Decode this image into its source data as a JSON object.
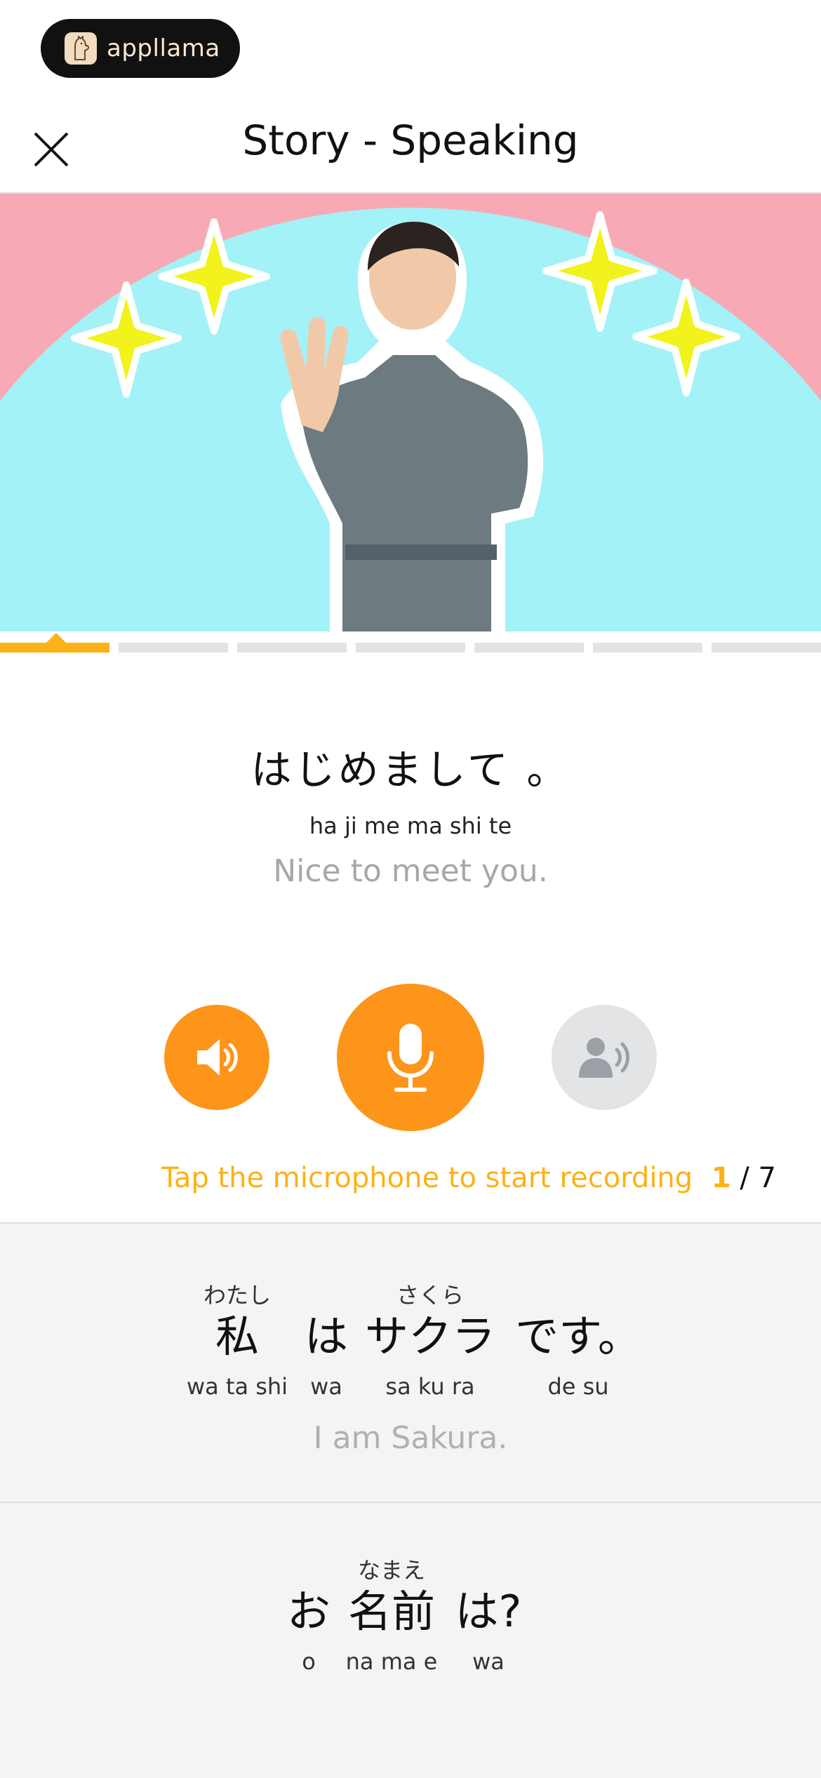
{
  "brand": {
    "name": "appllama"
  },
  "header": {
    "title": "Story - Speaking"
  },
  "progress": {
    "total_segments": 7,
    "current": 1
  },
  "current_sentence": {
    "japanese": "はじめまして 。",
    "romaji": "ha ji me ma shi te",
    "english": "Nice to meet you."
  },
  "controls": {
    "play_audio": "speaker-icon",
    "record": "microphone-icon",
    "playback": "user-voice-icon"
  },
  "hint": {
    "text": "Tap the microphone to start recording",
    "counter_current": "1",
    "counter_total": "/ 7"
  },
  "sentences": [
    {
      "words": [
        {
          "ruby": "わたし",
          "text": "私",
          "romaji": "wa ta shi"
        },
        {
          "ruby": "",
          "text": "は",
          "romaji": "wa"
        },
        {
          "ruby": "さくら",
          "text": "サクラ",
          "romaji": "sa ku ra"
        },
        {
          "ruby": "",
          "text": "です。",
          "romaji": "de su"
        }
      ],
      "english": "I am Sakura."
    },
    {
      "words": [
        {
          "ruby": "",
          "text": "お",
          "romaji": "o"
        },
        {
          "ruby": "なまえ",
          "text": "名前",
          "romaji": "na ma e"
        },
        {
          "ruby": "",
          "text": "は?",
          "romaji": "wa"
        }
      ]
    }
  ],
  "colors": {
    "accent": "#fc951a",
    "progress_active": "#fcb116",
    "hero_pink": "#f7aab6",
    "hero_blue": "#a3f2f8"
  }
}
